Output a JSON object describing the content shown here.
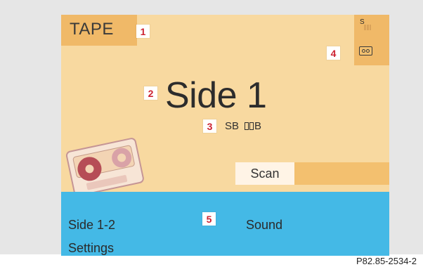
{
  "mode": {
    "label": "TAPE"
  },
  "status_icons": {
    "signal_label": "S",
    "tape_icon": "tape-icon"
  },
  "main": {
    "title": "Side 1",
    "sb_label": "SB",
    "dolby_label": "B"
  },
  "controls": {
    "scan_label": "Scan"
  },
  "bottom_menu": {
    "side_label": "Side 1-2",
    "sound_label": "Sound",
    "settings_label": "Settings"
  },
  "callouts": [
    "1",
    "2",
    "3",
    "4",
    "5"
  ],
  "caption": "P82.85-2534-2",
  "colors": {
    "background": "#e6e6e6",
    "panel": "#f8d9a0",
    "accent": "#f0b968",
    "menu_blue": "#44b9e6",
    "callout_text": "#cc2231"
  }
}
